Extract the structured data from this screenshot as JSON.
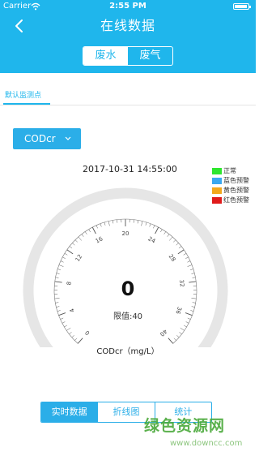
{
  "status_bar": {
    "carrier": "Carrier",
    "time": "2:55 PM"
  },
  "header": {
    "title": "在线数据",
    "back_icon": "chevron-left-icon",
    "segments": [
      {
        "label": "废水",
        "active": true
      },
      {
        "label": "废气",
        "active": false
      }
    ]
  },
  "station_tab": {
    "label": "默认监测点"
  },
  "pollutant_dropdown": {
    "selected": "CODcr",
    "icon": "chevron-down-icon"
  },
  "reading": {
    "timestamp": "2017-10-31 14:55:00",
    "value": "0",
    "limit_text": "限值:40",
    "unit_label": "CODcr（mg/L）",
    "gauge_min": 0,
    "gauge_max": 40,
    "gauge_value": 0,
    "tick_labels": [
      "0",
      "4",
      "8",
      "12",
      "16",
      "20",
      "24",
      "28",
      "32",
      "36",
      "40"
    ]
  },
  "legend": [
    {
      "label": "正常",
      "color": "#2ee62e"
    },
    {
      "label": "蓝色预警",
      "color": "#3aa8f0"
    },
    {
      "label": "黄色预警",
      "color": "#f2a81d"
    },
    {
      "label": "红色预警",
      "color": "#e01b1b"
    }
  ],
  "bottom_tabs": [
    {
      "label": "实时数据",
      "active": true
    },
    {
      "label": "折线图",
      "active": false
    },
    {
      "label": "统计",
      "active": false
    }
  ],
  "watermark": {
    "main": "绿色资源网",
    "url": "www.downcc.com"
  },
  "colors": {
    "accent": "#1fb6ec",
    "button": "#2baee8",
    "gauge_track": "#e6e6e6"
  }
}
